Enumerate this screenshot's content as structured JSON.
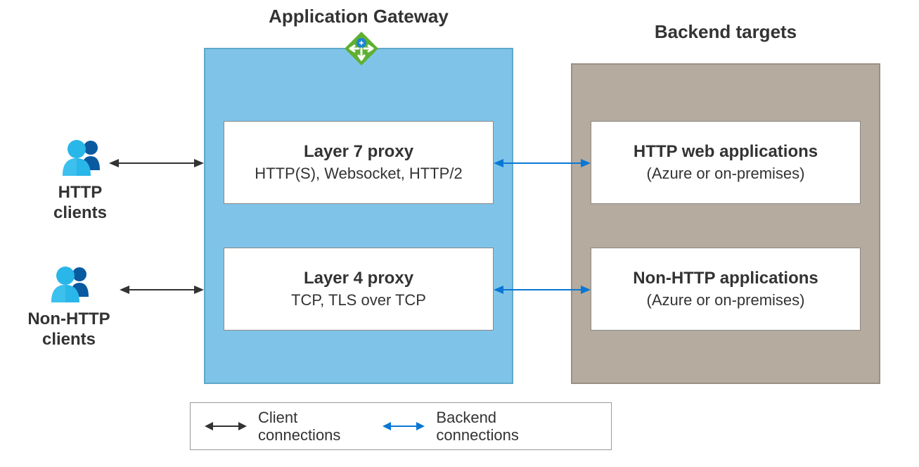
{
  "gateway": {
    "title": "Application Gateway",
    "proxies": {
      "layer7": {
        "title": "Layer 7 proxy",
        "subtitle": "HTTP(S), Websocket, HTTP/2"
      },
      "layer4": {
        "title": "Layer 4 proxy",
        "subtitle": "TCP, TLS over TCP"
      }
    }
  },
  "clients": {
    "http": {
      "label": "HTTP\nclients"
    },
    "nonhttp": {
      "label": "Non-HTTP\nclients"
    }
  },
  "backend": {
    "title": "Backend targets",
    "targets": {
      "http": {
        "title": "HTTP web applications",
        "subtitle": "(Azure or on-premises)"
      },
      "nonhttp": {
        "title": "Non-HTTP applications",
        "subtitle": "(Azure or on-premises)"
      }
    }
  },
  "legend": {
    "client": "Client\nconnections",
    "backend": "Backend\nconnections"
  },
  "colors": {
    "gatewayBg": "#7fc4e8",
    "backendBg": "#b5ab9e",
    "clientArrow": "#333333",
    "backendArrow": "#0a77d4"
  }
}
